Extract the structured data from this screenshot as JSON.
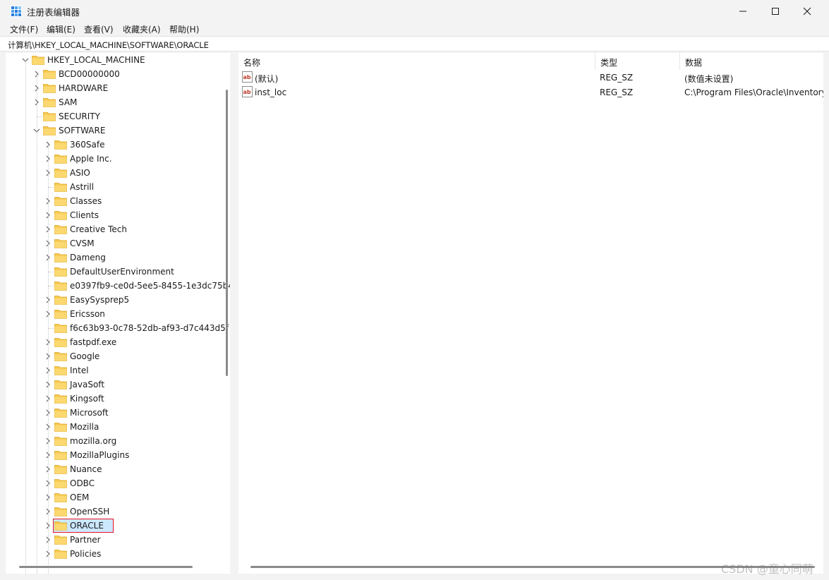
{
  "window": {
    "title": "注册表编辑器"
  },
  "menu": [
    {
      "label": "文件(F)"
    },
    {
      "label": "编辑(E)"
    },
    {
      "label": "查看(V)"
    },
    {
      "label": "收藏夹(A)"
    },
    {
      "label": "帮助(H)"
    }
  ],
  "address": "计算机\\HKEY_LOCAL_MACHINE\\SOFTWARE\\ORACLE",
  "tree": {
    "root": "HKEY_LOCAL_MACHINE",
    "hklm_children": [
      "BCD00000000",
      "HARDWARE",
      "SAM",
      "SECURITY",
      "SOFTWARE"
    ],
    "software_children": [
      "360Safe",
      "Apple Inc.",
      "ASIO",
      "Astrill",
      "Classes",
      "Clients",
      "Creative Tech",
      "CVSM",
      "Dameng",
      "DefaultUserEnvironment",
      "e0397fb9-ce0d-5ee5-8455-1e3dc75b4",
      "EasySysprep5",
      "Ericsson",
      "f6c63b93-0c78-52db-af93-d7c443d5f",
      "fastpdf.exe",
      "Google",
      "Intel",
      "JavaSoft",
      "Kingsoft",
      "Microsoft",
      "Mozilla",
      "mozilla.org",
      "MozillaPlugins",
      "Nuance",
      "ODBC",
      "OEM",
      "OpenSSH",
      "ORACLE",
      "Partner",
      "Policies"
    ],
    "selected": "ORACLE"
  },
  "list": {
    "columns": [
      "名称",
      "类型",
      "数据"
    ],
    "rows": [
      {
        "name": "(默认)",
        "type": "REG_SZ",
        "data": "(数值未设置)"
      },
      {
        "name": "inst_loc",
        "type": "REG_SZ",
        "data": "C:\\Program Files\\Oracle\\Inventory"
      }
    ]
  },
  "watermark": "CSDN @童心同萌",
  "colors": {
    "folder": "#f8c94c",
    "selection_border": "#e81123",
    "selection_fill": "#cce8ff"
  }
}
